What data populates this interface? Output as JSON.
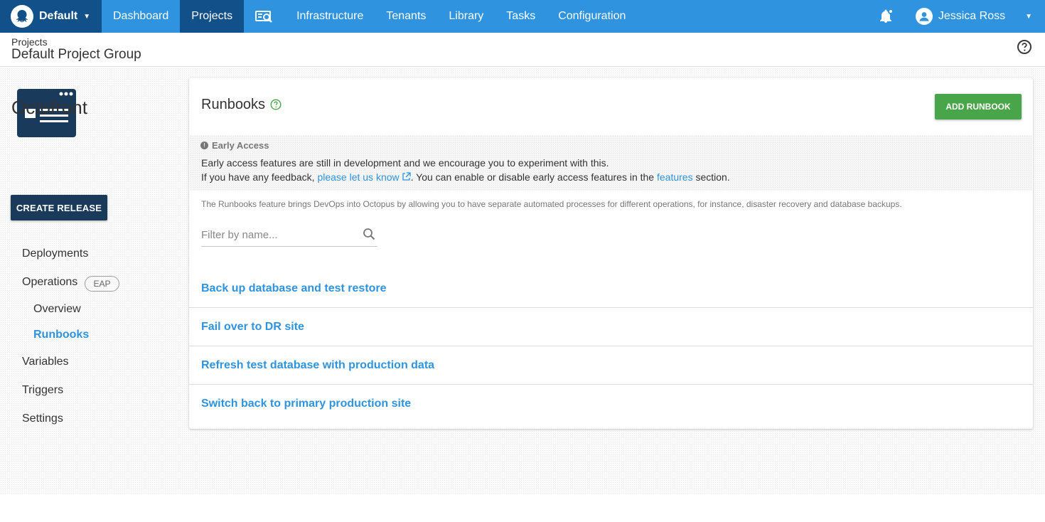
{
  "topnav": {
    "space_label": "Default",
    "items": [
      {
        "label": "Dashboard"
      },
      {
        "label": "Projects"
      },
      {
        "label": "Infrastructure"
      },
      {
        "label": "Tenants"
      },
      {
        "label": "Library"
      },
      {
        "label": "Tasks"
      },
      {
        "label": "Configuration"
      }
    ],
    "active_item": "Projects",
    "user_name": "Jessica Ross",
    "colors": {
      "bar": "#2f93e0",
      "active": "#125089"
    }
  },
  "header": {
    "breadcrumb": "Projects",
    "title": "Default Project Group"
  },
  "sidebar": {
    "project_name": "Octofront",
    "create_release_label": "CREATE RELEASE",
    "items": [
      {
        "label": "Deployments"
      },
      {
        "label": "Operations",
        "badge": "EAP"
      },
      {
        "label": "Overview"
      },
      {
        "label": "Runbooks"
      },
      {
        "label": "Variables"
      },
      {
        "label": "Triggers"
      },
      {
        "label": "Settings"
      }
    ],
    "selected_item": "Runbooks"
  },
  "main": {
    "title": "Runbooks",
    "add_button_label": "ADD RUNBOOK",
    "early_access": {
      "heading": "Early Access",
      "line1": "Early access features are still in development and we encourage you to experiment with this.",
      "line2_prefix": "If you have any feedback, ",
      "line2_link": "please let us know",
      "line2_middle": ". You can enable or disable early access features in the ",
      "line2_link2": "features",
      "line2_suffix": " section."
    },
    "description": "The Runbooks feature brings DevOps into Octopus by allowing you to have separate automated processes for different operations, for instance, disaster recovery and database backups.",
    "filter": {
      "placeholder": "Filter by name...",
      "value": ""
    },
    "runbooks": [
      {
        "name": "Back up database and test restore"
      },
      {
        "name": "Fail over to DR site"
      },
      {
        "name": "Refresh test database with production data"
      },
      {
        "name": "Switch back to primary production site"
      }
    ],
    "colors": {
      "link": "#2f93e0",
      "add_button": "#48a54a",
      "create_release": "#1a3a5c"
    }
  }
}
